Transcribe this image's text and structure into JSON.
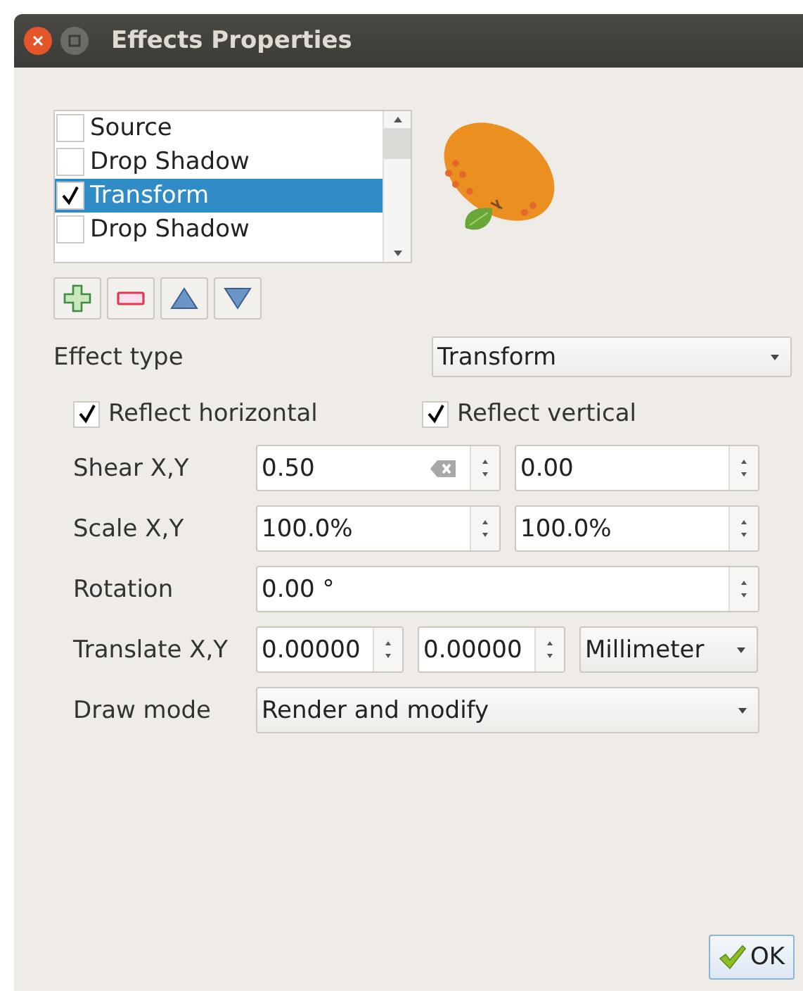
{
  "window": {
    "title": "Effects Properties"
  },
  "effects": [
    {
      "label": "Source",
      "checked": false,
      "selected": false
    },
    {
      "label": "Drop Shadow",
      "checked": false,
      "selected": false
    },
    {
      "label": "Transform",
      "checked": true,
      "selected": true
    },
    {
      "label": "Drop Shadow",
      "checked": false,
      "selected": false
    }
  ],
  "effect_type": {
    "label": "Effect type",
    "value": "Transform"
  },
  "reflect": [
    {
      "label": "Reflect horizontal",
      "checked": true
    },
    {
      "label": "Reflect vertical",
      "checked": true
    }
  ],
  "properties": [
    {
      "kind": "spin_pair",
      "label": "Shear X,Y",
      "fields": [
        {
          "value": "0.50",
          "clearable": true
        },
        {
          "value": "0.00",
          "clearable": false
        }
      ]
    },
    {
      "kind": "spin_pair",
      "label": "Scale X,Y",
      "fields": [
        {
          "value": "100.0%",
          "clearable": false
        },
        {
          "value": "100.0%",
          "clearable": false
        }
      ]
    },
    {
      "kind": "spin_single",
      "label": "Rotation",
      "fields": [
        {
          "value": "0.00 °",
          "clearable": false
        }
      ]
    },
    {
      "kind": "spin_unit",
      "label": "Translate X,Y",
      "fields": [
        {
          "value": "0.00000",
          "clearable": false
        },
        {
          "value": "0.00000",
          "clearable": false
        }
      ],
      "unit": "Millimeter"
    },
    {
      "kind": "combo",
      "label": "Draw mode",
      "value": "Render and modify"
    }
  ],
  "ok_button": {
    "label": "OK"
  }
}
